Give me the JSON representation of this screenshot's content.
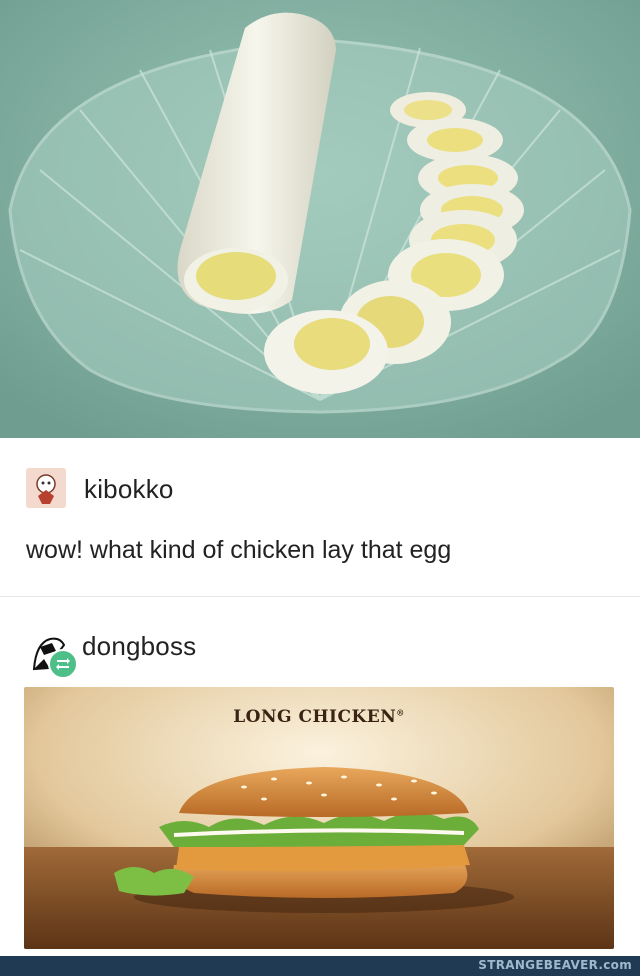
{
  "photo": {
    "subject": "long boiled egg on glass shell plate"
  },
  "posts": [
    {
      "username": "kibokko",
      "text": "wow! what kind of chicken lay that egg",
      "avatar_icon": "cartoon-avatar-icon"
    },
    {
      "username": "dongboss",
      "avatar_icon": "raccoon-avatar-icon",
      "badge_icon": "reblog-icon"
    }
  ],
  "ad": {
    "title": "LONG CHICKEN",
    "trademark": "®"
  },
  "footer": {
    "watermark": "STRANGEBEAVER.com"
  },
  "colors": {
    "photo_bg": "#85b2a4",
    "reblog_badge": "#4fbf8a",
    "footer_bar": "#1f3a52"
  }
}
